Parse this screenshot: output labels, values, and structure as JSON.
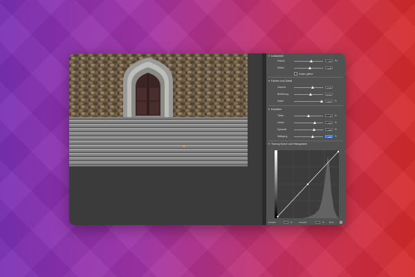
{
  "panel": {
    "sections": [
      {
        "title": "Lesbarkeit",
        "rows": [
          {
            "label": "Radius",
            "value": "67",
            "unit": "Px",
            "level": 0.6
          },
          {
            "label": "Stärke",
            "value": "1,08",
            "unit": "",
            "level": 0.55
          }
        ],
        "checkbox": "Kanten glätten"
      },
      {
        "title": "Farben und Detail",
        "rows": [
          {
            "label": "Gamma",
            "value": "0,29",
            "unit": "",
            "level": 0.65
          },
          {
            "label": "Belichtung",
            "value": "+0,34",
            "unit": "",
            "level": 0.58
          },
          {
            "label": "Detail",
            "value": "+100",
            "unit": "%",
            "level": 0.95
          }
        ]
      },
      {
        "title": "Erweitert",
        "rows": [
          {
            "label": "Tiefen",
            "value": "0",
            "unit": "%",
            "level": 0.5
          },
          {
            "label": "Lichter",
            "value": "+44",
            "unit": "%",
            "level": 0.72
          },
          {
            "label": "Dynamik",
            "value": "+39",
            "unit": "%",
            "level": 0.7
          },
          {
            "label": "Sättigung",
            "value": "+29",
            "unit": "%",
            "level": 0.64,
            "active": true
          }
        ]
      },
      {
        "title": "Tonung Kurve und Histogramm"
      }
    ],
    "bottom": {
      "input_label": "Eingabe",
      "input_unit": "%",
      "output_label": "Ausgabe",
      "output_unit": "%",
      "mode": "Ecke"
    }
  },
  "colors": {
    "accent": "#2f6fd6",
    "panel": "#525252",
    "window": "#3a3a3a"
  }
}
